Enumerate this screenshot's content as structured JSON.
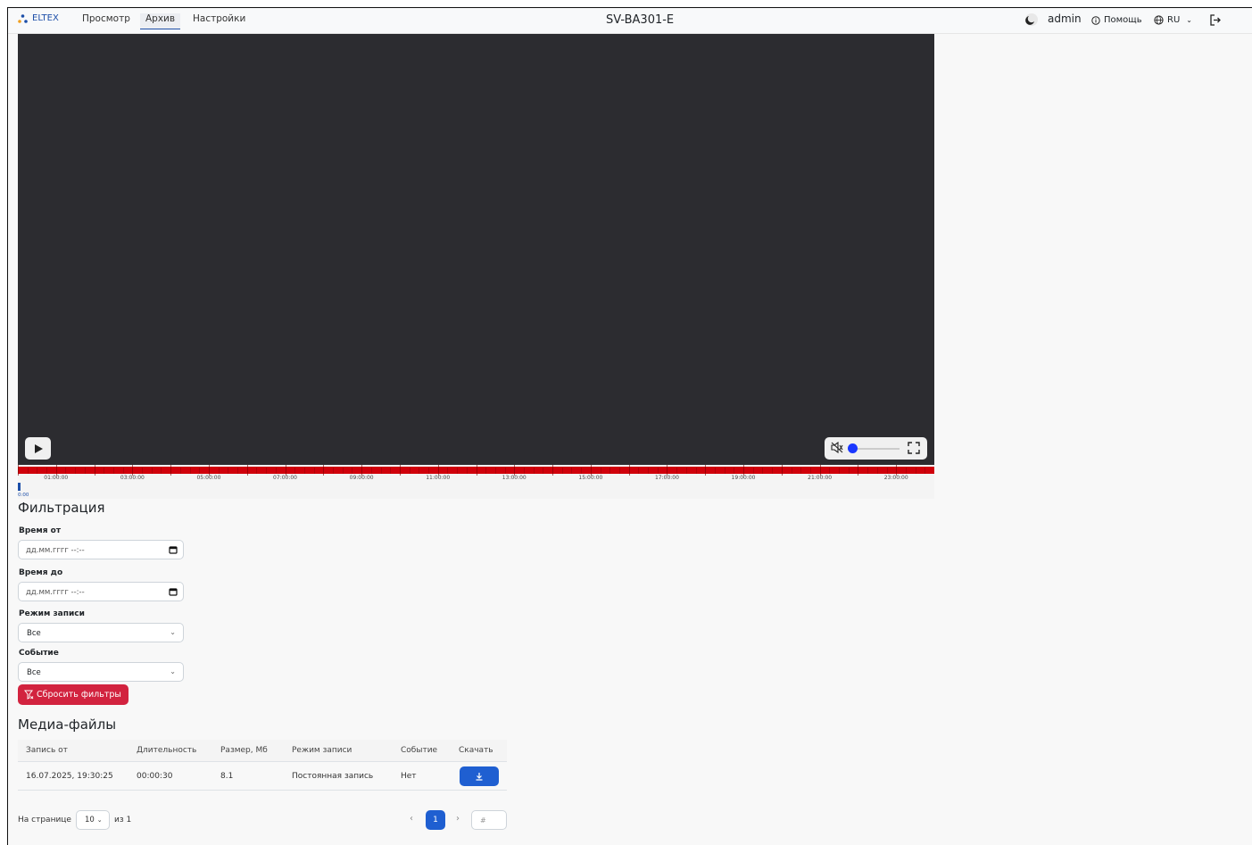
{
  "navbar": {
    "brand": "ELTEX",
    "links": [
      "Просмотр",
      "Архив",
      "Настройки"
    ],
    "active_link": "Архив",
    "device_title": "SV-BA301-E",
    "user": "admin",
    "help": "Помощь",
    "language": "RU"
  },
  "player": {
    "timeline_labels": [
      "01:00:00",
      "03:00:00",
      "05:00:00",
      "07:00:00",
      "09:00:00",
      "11:00:00",
      "13:00:00",
      "15:00:00",
      "17:00:00",
      "19:00:00",
      "21:00:00",
      "23:00:00"
    ],
    "timeline_start": "0:00",
    "volume": 0,
    "colors": {
      "timeline": "#d0000b",
      "volume_knob": "#1a37ff",
      "video_bg": "#2c2c30"
    }
  },
  "filters": {
    "title": "Фильтрация",
    "time_from_label": "Время от",
    "time_from_placeholder": "дд.мм.гггг --:--",
    "time_to_label": "Время до",
    "time_to_placeholder": "дд.мм.гггг --:--",
    "record_mode_label": "Режим записи",
    "record_mode_value": "Все",
    "event_label": "Событие",
    "event_value": "Все",
    "reset_label": "Сбросить фильтры"
  },
  "media": {
    "title": "Медиа-файлы",
    "columns": [
      "Запись от",
      "Длительность",
      "Размер, Мб",
      "Режим записи",
      "Событие",
      "Скачать"
    ],
    "rows": [
      [
        "16.07.2025, 19:30:25",
        "00:00:30",
        "8.1",
        "Постоянная запись",
        "Нет"
      ]
    ]
  },
  "pagination": {
    "per_page_label": "На странице",
    "per_page_value": "10",
    "of_label": "из 1",
    "current_page": "1",
    "page_input_placeholder": "#"
  }
}
